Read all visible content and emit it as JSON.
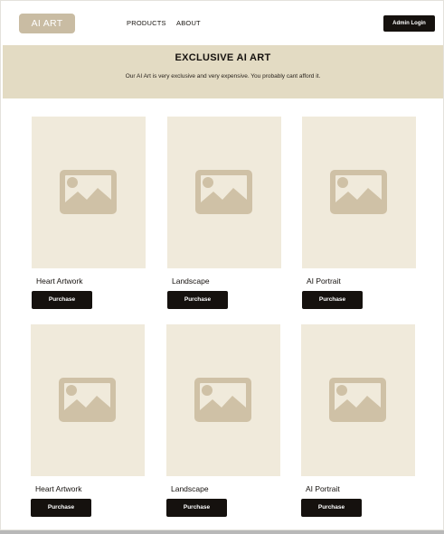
{
  "nav": {
    "logo": "AI ART",
    "links": [
      "PRODUCTS",
      "ABOUT"
    ],
    "admin_button": "Admin Login"
  },
  "hero": {
    "title": "EXCLUSIVE AI ART",
    "subtitle": "Our AI Art is very exclusive and very expensive. You probably cant afford it."
  },
  "products": [
    {
      "title": "Heart Artwork",
      "button": "Purchase",
      "icon": "image-placeholder-icon"
    },
    {
      "title": "Landscape",
      "button": "Purchase",
      "icon": "image-placeholder-icon"
    },
    {
      "title": "AI Portrait",
      "button": "Purchase",
      "icon": "image-placeholder-icon"
    },
    {
      "title": "Heart Artwork",
      "button": "Purchase",
      "icon": "image-placeholder-icon"
    },
    {
      "title": "Landscape",
      "button": "Purchase",
      "icon": "image-placeholder-icon"
    },
    {
      "title": "AI Portrait",
      "button": "Purchase",
      "icon": "image-placeholder-icon"
    }
  ],
  "colors": {
    "hero_background": "#e3dbc3",
    "logo_background": "#c9bca3",
    "placeholder_background": "#f0eadb",
    "placeholder_icon": "#cfc1a6",
    "button": "#15110e"
  }
}
